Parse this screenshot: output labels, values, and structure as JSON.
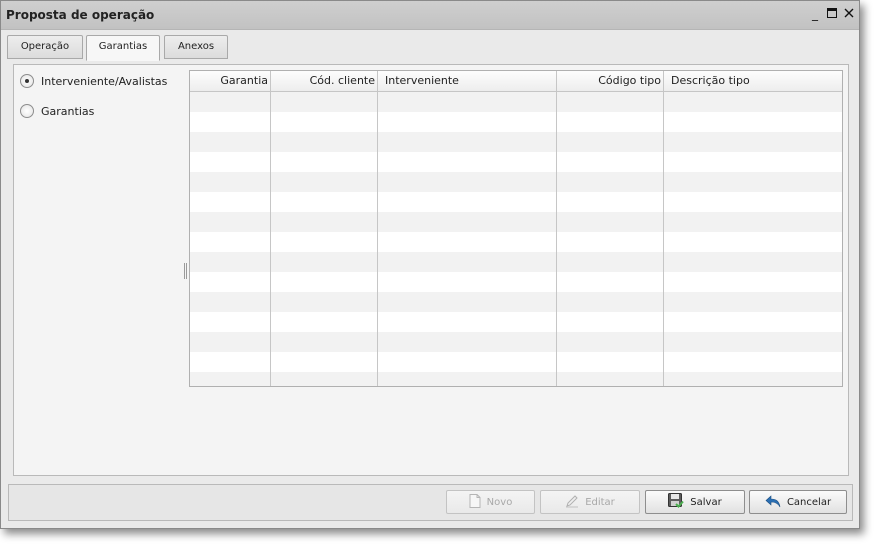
{
  "window": {
    "title": "Proposta de operação",
    "controls": {
      "minimize": "_",
      "maximize": "☐",
      "close": "✕"
    }
  },
  "tabs": [
    {
      "label": "Operação",
      "active": false
    },
    {
      "label": "Garantias",
      "active": true
    },
    {
      "label": "Anexos",
      "active": false
    }
  ],
  "options": [
    {
      "label": "Interveniente/Avalistas",
      "selected": true
    },
    {
      "label": "Garantias",
      "selected": false
    }
  ],
  "table": {
    "columns": [
      "Garantia",
      "Cód. cliente",
      "Interveniente",
      "Código tipo",
      "Descrição tipo"
    ],
    "rows": []
  },
  "footer": {
    "novo": {
      "label": "Novo",
      "enabled": false,
      "icon": "document-icon"
    },
    "editar": {
      "label": "Editar",
      "enabled": false,
      "icon": "pencil-icon"
    },
    "salvar": {
      "label": "Salvar",
      "enabled": true,
      "icon": "save-icon"
    },
    "cancelar": {
      "label": "Cancelar",
      "enabled": true,
      "icon": "undo-icon"
    }
  },
  "colors": {
    "accent_green": "#4caf50",
    "accent_blue": "#2a6fb3"
  }
}
